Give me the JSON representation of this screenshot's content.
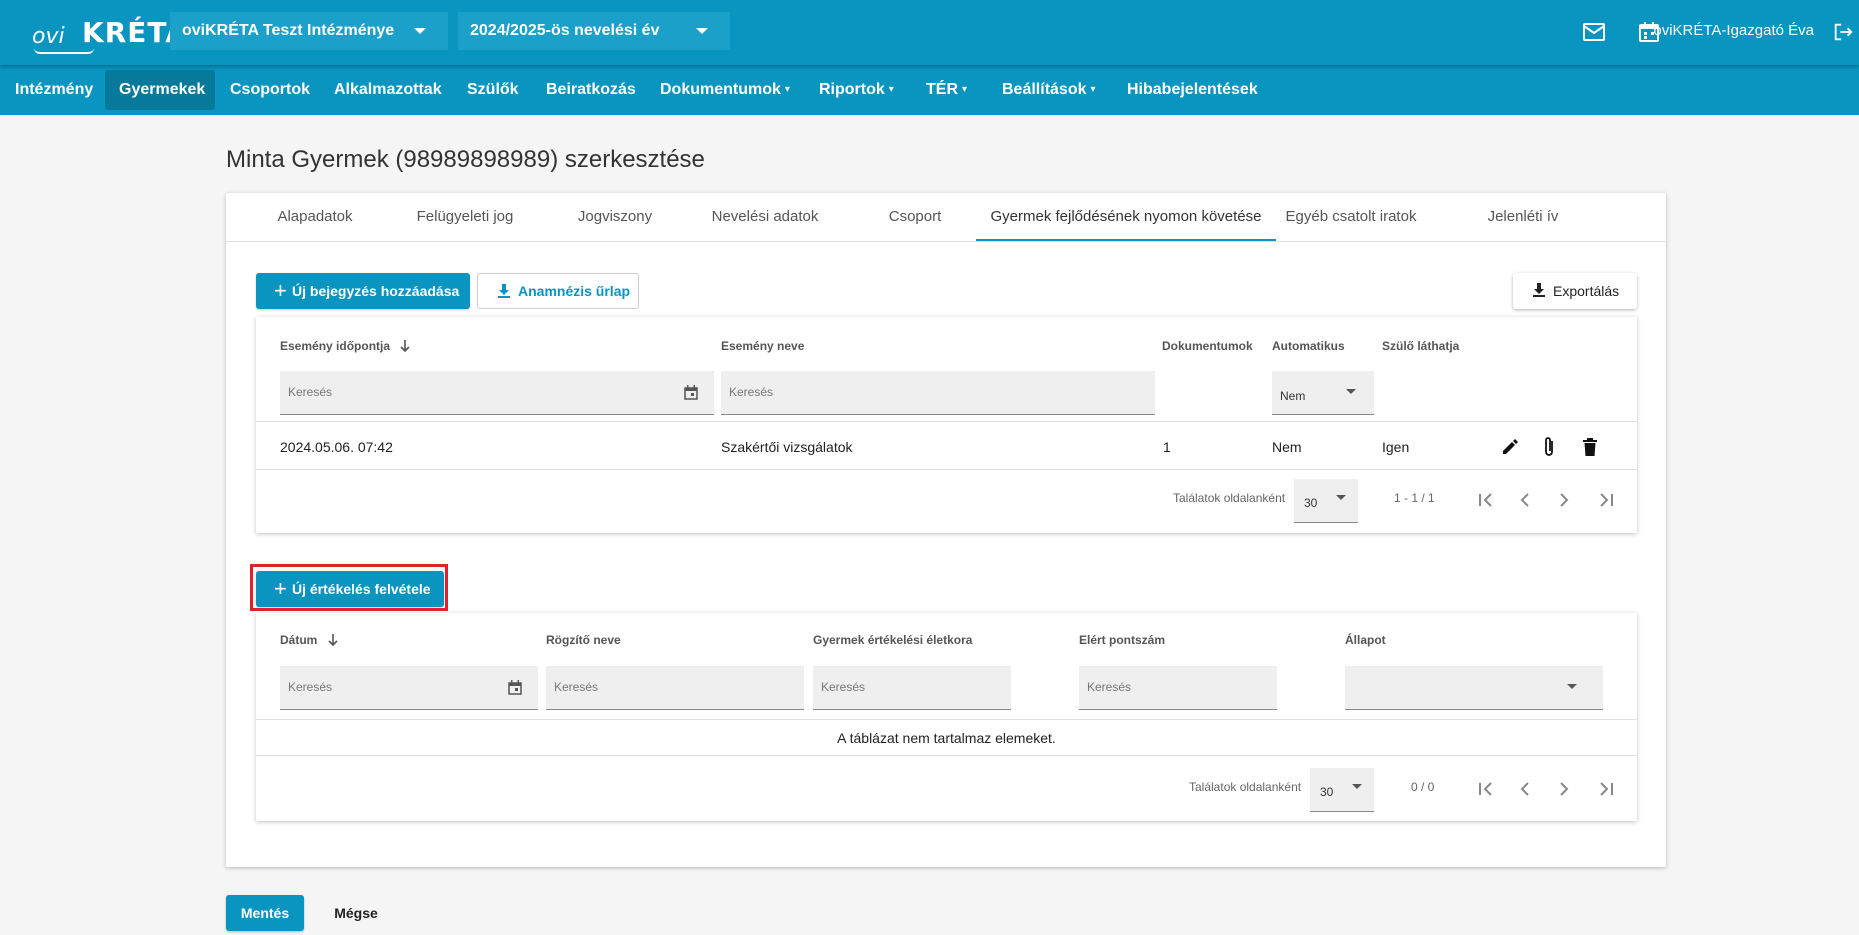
{
  "app": {
    "logo_ovi": "ovi",
    "logo_kreta": "KRÉTA"
  },
  "header": {
    "institution": "oviKRÉTA Teszt Intézménye",
    "year": "2024/2025-ös nevelési év",
    "user": "oviKRÉTA-Igazgató Éva",
    "icons": [
      "mail-icon",
      "calendar-icon",
      "logout-icon"
    ]
  },
  "nav": {
    "items": [
      {
        "label": "Intézmény",
        "dropdown": false
      },
      {
        "label": "Gyermekek",
        "dropdown": false,
        "active": true
      },
      {
        "label": "Csoportok",
        "dropdown": false
      },
      {
        "label": "Alkalmazottak",
        "dropdown": false
      },
      {
        "label": "Szülők",
        "dropdown": false
      },
      {
        "label": "Beiratkozás",
        "dropdown": false
      },
      {
        "label": "Dokumentumok",
        "dropdown": true
      },
      {
        "label": "Riportok",
        "dropdown": true
      },
      {
        "label": "TÉR",
        "dropdown": true
      },
      {
        "label": "Beállítások",
        "dropdown": true
      },
      {
        "label": "Hibabejelentések",
        "dropdown": false
      }
    ],
    "dropdown_glyph": "▾"
  },
  "page": {
    "title": "Minta Gyermek (98989898989) szerkesztése"
  },
  "tabs": [
    "Alapadatok",
    "Felügyeleti jog",
    "Jogviszony",
    "Nevelési adatok",
    "Csoport",
    "Gyermek fejlődésének nyomon követése",
    "Egyéb csatolt iratok",
    "Jelenléti ív"
  ],
  "events": {
    "add_button": "Új bejegyzés hozzáadása",
    "anamnesis_button": "Anamnézis űrlap",
    "export_button": "Exportálás",
    "columns": {
      "date": "Esemény időpontja",
      "name": "Esemény neve",
      "docs": "Dokumentumok",
      "auto": "Automatikus",
      "parent": "Szülő láthatja"
    },
    "filters": {
      "date_placeholder": "Keresés",
      "name_placeholder": "Keresés",
      "auto_value": "Nem"
    },
    "rows": [
      {
        "date": "2024.05.06. 07:42",
        "name": "Szakértői vizsgálatok",
        "docs": "1",
        "auto": "Nem",
        "parent": "Igen"
      }
    ],
    "pager": {
      "label": "Találatok oldalanként",
      "page_size": "30",
      "range": "1 - 1 / 1"
    }
  },
  "evaluations": {
    "add_button": "Új értékelés felvétele",
    "columns": {
      "date": "Dátum",
      "recorder": "Rögzítő neve",
      "age": "Gyermek értékelési életkora",
      "score": "Elért pontszám",
      "status": "Állapot"
    },
    "filters": {
      "date_placeholder": "Keresés",
      "recorder_placeholder": "Keresés",
      "age_placeholder": "Keresés",
      "score_placeholder": "Keresés",
      "status_value": ""
    },
    "empty_message": "A táblázat nem tartalmaz elemeket.",
    "pager": {
      "label": "Találatok oldalanként",
      "page_size": "30",
      "range": "0 / 0"
    }
  },
  "footer": {
    "save": "Mentés",
    "cancel": "Mégse"
  },
  "colors": {
    "primary": "#0a95c0",
    "highlight": "#e0202a"
  }
}
